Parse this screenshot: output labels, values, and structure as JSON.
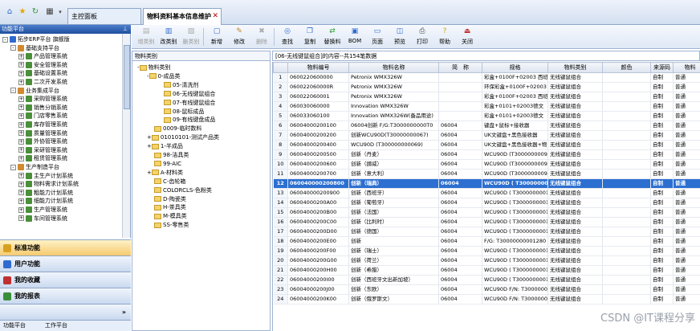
{
  "tabs": [
    {
      "label": "主控面板"
    },
    {
      "label": "物料资料基本信息维护"
    }
  ],
  "left": {
    "header": "功能平台",
    "tree": [
      {
        "label": "拓步ERP平台 旗舰版",
        "lvl": 0,
        "pm": "-"
      },
      {
        "label": "基础支持平台",
        "lvl": 1,
        "pm": "-"
      },
      {
        "label": "产品管理系统",
        "lvl": 2,
        "pm": "+"
      },
      {
        "label": "安全管理系统",
        "lvl": 2,
        "pm": "+"
      },
      {
        "label": "基础设置系统",
        "lvl": 2,
        "pm": "+"
      },
      {
        "label": "二次开发系统",
        "lvl": 2,
        "pm": "+"
      },
      {
        "label": "业务集成平台",
        "lvl": 1,
        "pm": "-"
      },
      {
        "label": "采购管理系统",
        "lvl": 2,
        "pm": "+"
      },
      {
        "label": "销售分销系统",
        "lvl": 2,
        "pm": "+"
      },
      {
        "label": "门店零售系统",
        "lvl": 2,
        "pm": "+"
      },
      {
        "label": "库存管理系统",
        "lvl": 2,
        "pm": "+"
      },
      {
        "label": "质量管理系统",
        "lvl": 2,
        "pm": "+"
      },
      {
        "label": "外协管理系统",
        "lvl": 2,
        "pm": "+"
      },
      {
        "label": "采研管理系统",
        "lvl": 2,
        "pm": "+"
      },
      {
        "label": "租赁管理系统",
        "lvl": 2,
        "pm": "+"
      },
      {
        "label": "生产制造平台",
        "lvl": 1,
        "pm": "-"
      },
      {
        "label": "主生产计划系统",
        "lvl": 2,
        "pm": "+"
      },
      {
        "label": "物料需求计划系统",
        "lvl": 2,
        "pm": "+"
      },
      {
        "label": "粗能力计划系统",
        "lvl": 2,
        "pm": "+"
      },
      {
        "label": "细能力计划系统",
        "lvl": 2,
        "pm": "+"
      },
      {
        "label": "生产管理系统",
        "lvl": 2,
        "pm": "+"
      },
      {
        "label": "车间管理系统",
        "lvl": 2,
        "pm": "+"
      }
    ],
    "nav": [
      "标准功能",
      "用户功能",
      "我的收藏",
      "我的报表"
    ],
    "bottom_tabs": [
      "功能平台",
      "工作平台"
    ]
  },
  "toolbar": [
    {
      "label": "增类别",
      "icon": "add-category",
      "disabled": true
    },
    {
      "label": "改类别",
      "icon": "edit-category",
      "disabled": false
    },
    {
      "label": "删类别",
      "icon": "delete-category",
      "disabled": true
    },
    {
      "label": "新增",
      "icon": "new-doc",
      "disabled": false
    },
    {
      "label": "修改",
      "icon": "edit-pencil",
      "disabled": false
    },
    {
      "label": "删除",
      "icon": "delete",
      "disabled": true
    },
    {
      "label": "查找",
      "icon": "binoculars",
      "disabled": false
    },
    {
      "label": "复制",
      "icon": "copy",
      "disabled": false
    },
    {
      "label": "替换料",
      "icon": "replace",
      "disabled": false
    },
    {
      "label": "BOM",
      "icon": "bom",
      "disabled": false
    },
    {
      "label": "页面",
      "icon": "page",
      "disabled": false
    },
    {
      "label": "预览",
      "icon": "preview",
      "disabled": false
    },
    {
      "label": "打印",
      "icon": "printer",
      "disabled": false
    },
    {
      "label": "帮助",
      "icon": "help",
      "disabled": false
    },
    {
      "label": "关闭",
      "icon": "exit",
      "disabled": false
    }
  ],
  "category": {
    "header": "物料类别",
    "tree": [
      {
        "label": "物料类别",
        "lvl": 0,
        "pm": "-"
      },
      {
        "label": "0-成品类",
        "lvl": 1,
        "pm": "-"
      },
      {
        "label": "05-清洗剂",
        "lvl": 2,
        "pm": ""
      },
      {
        "label": "06-无线键鼠组合",
        "lvl": 2,
        "pm": ""
      },
      {
        "label": "07-有线键鼠组合",
        "lvl": 2,
        "pm": ""
      },
      {
        "label": "08-鼠标成品",
        "lvl": 2,
        "pm": ""
      },
      {
        "label": "09-有线键盘成品",
        "lvl": 2,
        "pm": ""
      },
      {
        "label": "0009-临时数料",
        "lvl": 1,
        "pm": ""
      },
      {
        "label": "01010101-测试产品类",
        "lvl": 1,
        "pm": "+"
      },
      {
        "label": "1-半成品",
        "lvl": 1,
        "pm": "+"
      },
      {
        "label": "98-洁具类",
        "lvl": 1,
        "pm": ""
      },
      {
        "label": "99-AIC",
        "lvl": 1,
        "pm": ""
      },
      {
        "label": "A-材料类",
        "lvl": 1,
        "pm": "+"
      },
      {
        "label": "C-齿轮箱",
        "lvl": 1,
        "pm": ""
      },
      {
        "label": "COLORCLS-色粉类",
        "lvl": 1,
        "pm": ""
      },
      {
        "label": "D-陶瓷类",
        "lvl": 1,
        "pm": ""
      },
      {
        "label": "H-茶具类",
        "lvl": 1,
        "pm": ""
      },
      {
        "label": "M-模具类",
        "lvl": 1,
        "pm": ""
      },
      {
        "label": "SS-零售类",
        "lvl": 1,
        "pm": ""
      }
    ]
  },
  "grid": {
    "caption": "[06-无线键鼠组合]的内容--共154笔数据",
    "columns": [
      "",
      "物料编号",
      "物料名称",
      "简　称",
      "规格",
      "物料类别",
      "颜色",
      "来源码",
      "物料"
    ],
    "rows": [
      [
        "1",
        "0600220600000",
        "Petronix WMX326W",
        "",
        "彩盒+0100F+02003 西班牙",
        "无线键鼠组合",
        "",
        "自制",
        "普通"
      ],
      [
        "2",
        "060022060000R",
        "Petronix WMX326W",
        "",
        "环保彩盒+0100F+02003",
        "无线键鼠组合",
        "",
        "自制",
        "普通"
      ],
      [
        "3",
        "060022060001",
        "Petronix WMX326W",
        "",
        "彩盒+0100F+02003 西班牙",
        "无线键鼠组合",
        "",
        "自制",
        "普通"
      ],
      [
        "4",
        "060030060000",
        "Innovation WMX326W",
        "",
        "彩盒+0101+02003德文",
        "无线键鼠组合",
        "",
        "自制",
        "普通"
      ],
      [
        "5",
        "060033060100",
        "Innovation WMX326W(备品用途)",
        "",
        "彩盒+0101+02003德文",
        "无线键鼠组合",
        "",
        "自制",
        "普通"
      ],
      [
        "6",
        "06004000200100",
        "06004创新 F/G:T3000000000T0",
        "06004",
        "键盘+鼠标+接收器",
        "无线键鼠组合",
        "",
        "自制",
        "普通"
      ],
      [
        "7",
        "06004000200200",
        "创新WCU90D(T30000000067)",
        "06004",
        "UK文键盘+黑色接收器",
        "无线键鼠组合",
        "",
        "自制",
        "普通"
      ],
      [
        "8",
        "06004000200400",
        "WCU90D (T300000000069)",
        "06004",
        "UK文键盘+黑色接收器+物",
        "无线键鼠组合",
        "",
        "自制",
        "普通"
      ],
      [
        "9",
        "06004000200500",
        "创新（丹麦）",
        "06004",
        "WCU90D (T30000000095)",
        "无线键鼠组合",
        "",
        "自制",
        "普通"
      ],
      [
        "10",
        "06004000200600",
        "创新（挪威）",
        "06004",
        "WCU90D (T30000000097)",
        "无线键鼠组合",
        "",
        "自制",
        "普通"
      ],
      [
        "11",
        "06004000200700",
        "创新（意大利）",
        "06004",
        "WCU90D (T30000000098)",
        "无线键鼠组合",
        "",
        "自制",
        "普通"
      ],
      [
        "12",
        "060040000200800",
        "创新（瑞典）",
        "06004",
        "WCU90D ( T300000000099)",
        "无线键鼠组合",
        "",
        "自制",
        "普通"
      ],
      [
        "13",
        "060040000200900",
        "创新（西班牙）",
        "06004",
        "WCU90D ( T300000000111)",
        "无线键鼠组合",
        "",
        "自制",
        "普通"
      ],
      [
        "14",
        "06004000200A00",
        "创新（葡萄牙）",
        "06004",
        "WCU90D ( T300000000112)",
        "无线键鼠组合",
        "",
        "自制",
        "普通"
      ],
      [
        "15",
        "06004000200B00",
        "创新（法国）",
        "06004",
        "WCU90D ( T300000000113)",
        "无线键鼠组合",
        "",
        "自制",
        "普通"
      ],
      [
        "16",
        "06004000200C00",
        "创新（比利时）",
        "06004",
        "WCU90D ( T300000000114)",
        "无线键鼠组合",
        "",
        "自制",
        "普通"
      ],
      [
        "17",
        "06004000200D00",
        "创新（德国）",
        "06004",
        "WCU90D ( T300000000115)",
        "无线键鼠组合",
        "",
        "自制",
        "普通"
      ],
      [
        "18",
        "06004000200E00",
        "创新",
        "06004",
        "F/G: T30000000001280",
        "无线键鼠组合",
        "",
        "自制",
        "普通"
      ],
      [
        "19",
        "06004000200F00",
        "创新（瑞士）",
        "06004",
        "WCU90D ( T300000000132)",
        "无线键鼠组合",
        "",
        "自制",
        "普通"
      ],
      [
        "20",
        "06004000200G00",
        "创新（荷兰）",
        "06004",
        "WCU90D ( T300000000134)",
        "无线键鼠组合",
        "",
        "自制",
        "普通"
      ],
      [
        "21",
        "06004000200H00",
        "创新（希腊）",
        "06004",
        "WCU90D ( T300000000135)",
        "无线键鼠组合",
        "",
        "自制",
        "普通"
      ],
      [
        "22",
        "06004000200I00",
        "创新（西班牙文出新加坡）",
        "06004",
        "WCU90D ( T300000000136)",
        "无线键鼠组合",
        "",
        "自制",
        "普通"
      ],
      [
        "23",
        "06004000200J00",
        "创新（东欧）",
        "06004",
        "WCU90D  F/N: T30000000",
        "无线键鼠组合",
        "",
        "自制",
        "普通"
      ],
      [
        "24",
        "06004000200K00",
        "创新（俄罗斯文）",
        "06004",
        "WCU90D  F/N: T30000000",
        "无线键鼠组合",
        "",
        "自制",
        "普通"
      ]
    ],
    "selected_row": "12"
  },
  "watermark": "CSDN @IT课程分享"
}
